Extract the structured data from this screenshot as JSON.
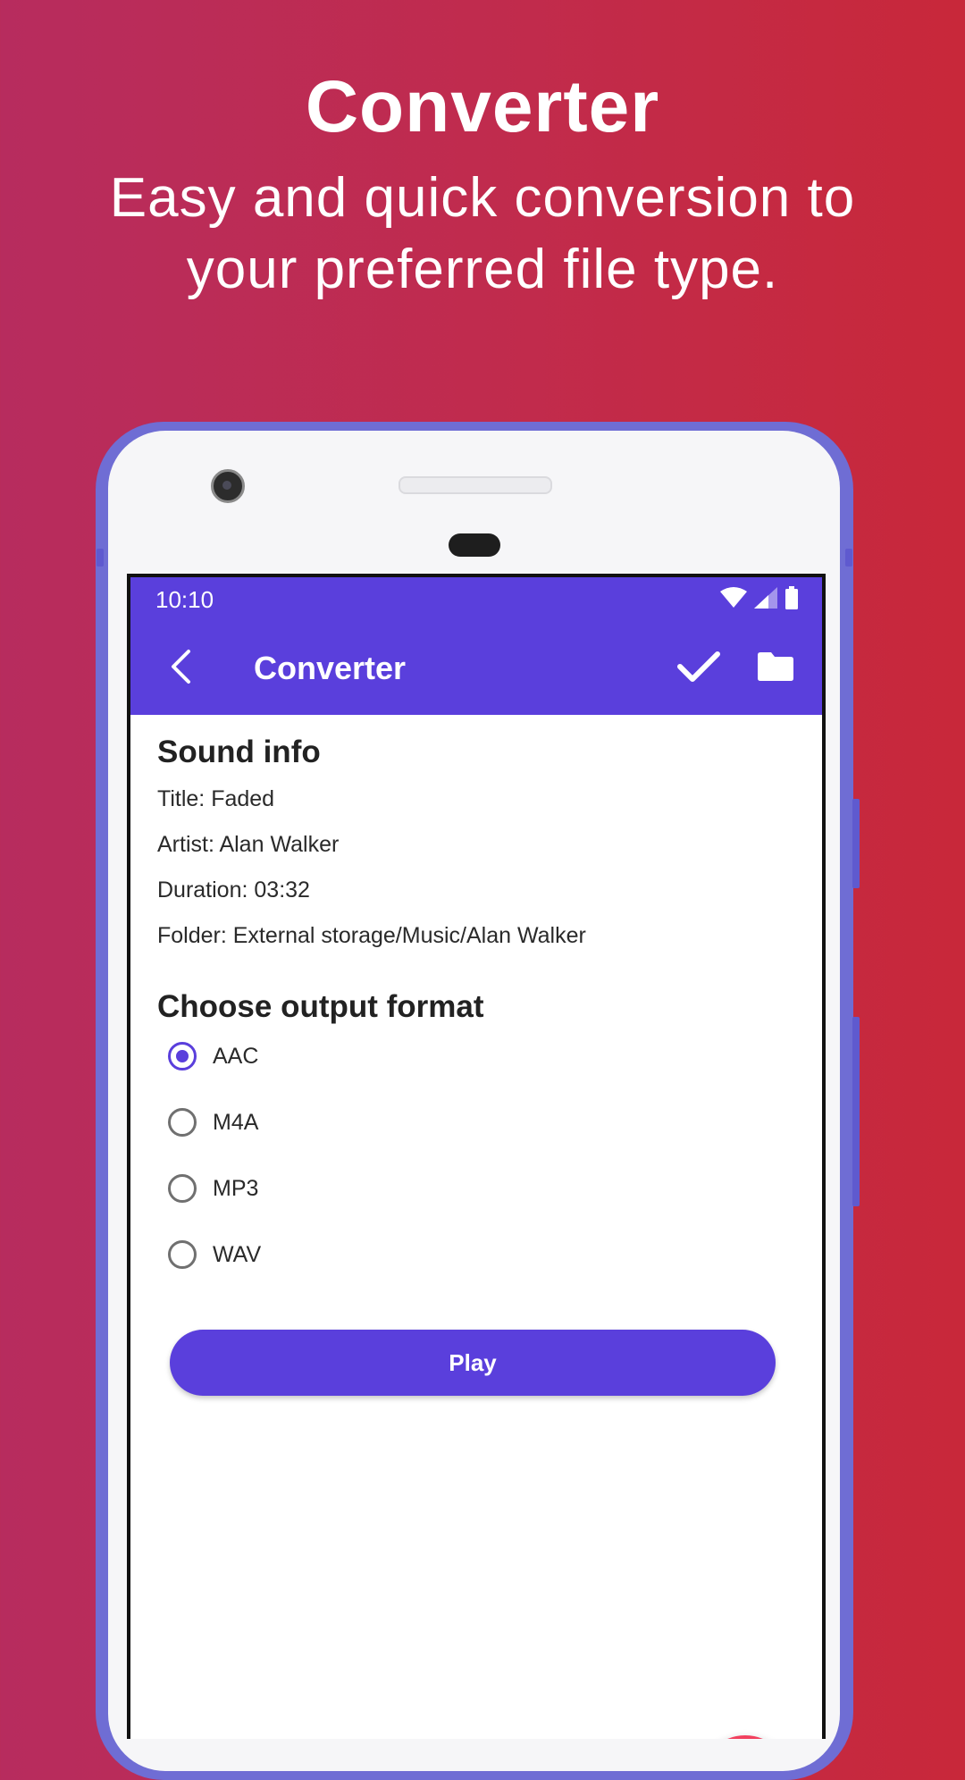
{
  "hero": {
    "title": "Converter",
    "subtitle": "Easy and quick conversion to your preferred file type."
  },
  "status_bar": {
    "time": "10:10",
    "icons": [
      "wifi-icon",
      "signal-icon",
      "battery-icon"
    ]
  },
  "app_bar": {
    "title": "Converter",
    "back_icon": "back-arrow-icon",
    "actions": [
      "check-icon",
      "folder-icon"
    ]
  },
  "sound_info": {
    "heading": "Sound info",
    "title": "Title: Faded",
    "artist": "Artist: Alan Walker",
    "duration": "Duration: 03:32",
    "folder": "Folder: External storage/Music/Alan Walker"
  },
  "output_format": {
    "heading": "Choose output format",
    "options": [
      {
        "label": "AAC",
        "selected": true
      },
      {
        "label": "M4A",
        "selected": false
      },
      {
        "label": "MP3",
        "selected": false
      },
      {
        "label": "WAV",
        "selected": false
      }
    ]
  },
  "play_button": {
    "label": "Play"
  },
  "fab": {
    "icon": "music-note-icon"
  },
  "colors": {
    "primary": "#5A3FDC",
    "fab": "#F2405E",
    "background_start": "#B72C5E",
    "background_end": "#C8283A"
  }
}
